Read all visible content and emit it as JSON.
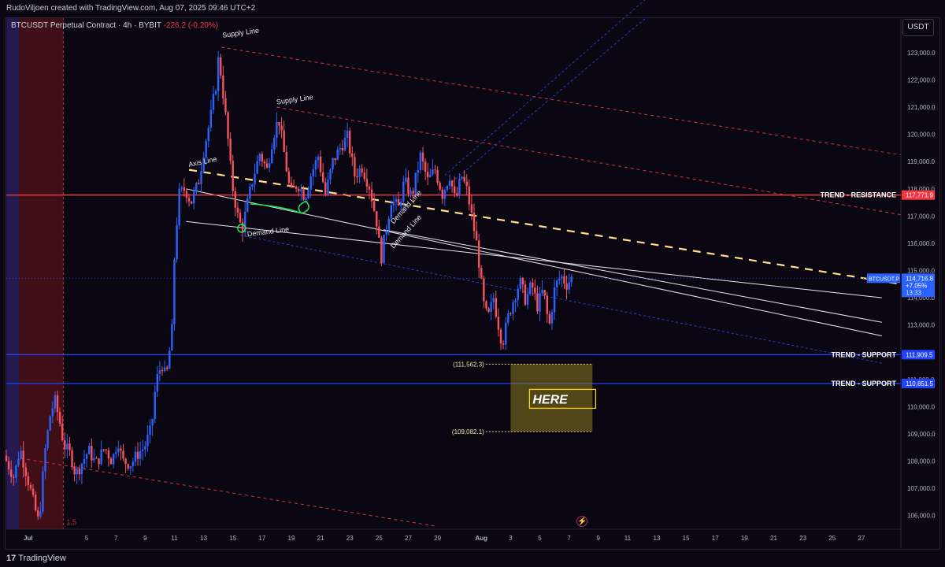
{
  "header": {
    "attribution": "RudoViljoen created with TradingView.com, Aug 07, 2025 09:46 UTC+2"
  },
  "legend": {
    "symbol": "BTCUSDT Perpetual Contract · 4h · BYBIT",
    "change": "-226.2 (-0.20%)"
  },
  "unit_button": "USDT",
  "footer": {
    "logo_mark": "17",
    "logo_text": "TradingView"
  },
  "colors": {
    "background": "#0b0712",
    "up": "#2962ff",
    "down": "#f7525f",
    "resistance": "#f23645",
    "support": "#2142ff",
    "axis_line": "#ffe08a",
    "zone": "#8c7a1f"
  },
  "chart_data": {
    "type": "candlestick",
    "symbol": "BTCUSDT.P",
    "timeframe": "4h",
    "exchange": "BYBIT",
    "ylim": [
      105500,
      124300
    ],
    "y_ticks": [
      106000,
      107000,
      108000,
      109000,
      110000,
      111000,
      112000,
      113000,
      114000,
      115000,
      116000,
      117000,
      118000,
      119000,
      120000,
      121000,
      122000,
      123000
    ],
    "y_tick_labels": [
      "106,000.0",
      "107,000.0",
      "108,000.0",
      "109,000.0",
      "110,000.0",
      "111,000.0",
      "112,000.0",
      "113,000.0",
      "114,000.0",
      "115,000.0",
      "116,000.0",
      "117,000.0",
      "118,000.0",
      "119,000.0",
      "120,000.0",
      "121,000.0",
      "122,000.0",
      "123,000.0"
    ],
    "x_ticks": [
      "Jul",
      "5",
      "7",
      "9",
      "11",
      "13",
      "15",
      "17",
      "19",
      "21",
      "23",
      "25",
      "27",
      "29",
      "Aug",
      "3",
      "5",
      "7",
      "9",
      "11",
      "13",
      "15",
      "17",
      "19",
      "21",
      "23",
      "25",
      "27"
    ],
    "x_tick_days": [
      1,
      5,
      7,
      9,
      11,
      13,
      15,
      17,
      19,
      21,
      23,
      25,
      27,
      29,
      32,
      34,
      36,
      38,
      40,
      42,
      44,
      46,
      48,
      50,
      52,
      54,
      56,
      58
    ],
    "x_domain_days": [
      -0.5,
      60.7
    ],
    "price_path": [
      [
        -0.5,
        108200
      ],
      [
        0.2,
        107400
      ],
      [
        0.6,
        108500
      ],
      [
        1.2,
        107200
      ],
      [
        1.6,
        106300
      ],
      [
        1.9,
        105700
      ],
      [
        2.3,
        108300
      ],
      [
        2.7,
        109800
      ],
      [
        3.0,
        110200
      ],
      [
        3.3,
        109500
      ],
      [
        3.6,
        108600
      ],
      [
        4.1,
        108200
      ],
      [
        4.4,
        107500
      ],
      [
        4.8,
        107900
      ],
      [
        5.3,
        108400
      ],
      [
        5.8,
        107900
      ],
      [
        6.4,
        108500
      ],
      [
        6.9,
        108000
      ],
      [
        7.3,
        108800
      ],
      [
        7.6,
        108000
      ],
      [
        8.2,
        107900
      ],
      [
        8.7,
        108300
      ],
      [
        9.1,
        108500
      ],
      [
        9.6,
        109200
      ],
      [
        9.9,
        110900
      ],
      [
        10.3,
        111600
      ],
      [
        10.6,
        111000
      ],
      [
        11.0,
        112800
      ],
      [
        11.2,
        116000
      ],
      [
        11.5,
        117800
      ],
      [
        11.9,
        118000
      ],
      [
        12.3,
        117500
      ],
      [
        12.8,
        118200
      ],
      [
        13.2,
        119500
      ],
      [
        13.6,
        120500
      ],
      [
        14.0,
        121800
      ],
      [
        14.2,
        122900
      ],
      [
        14.5,
        121500
      ],
      [
        14.8,
        120000
      ],
      [
        15.1,
        118200
      ],
      [
        15.5,
        117000
      ],
      [
        15.8,
        116500
      ],
      [
        16.1,
        117300
      ],
      [
        16.5,
        118300
      ],
      [
        17.0,
        119300
      ],
      [
        17.5,
        118700
      ],
      [
        17.9,
        119900
      ],
      [
        18.3,
        120600
      ],
      [
        18.7,
        119200
      ],
      [
        19.1,
        117800
      ],
      [
        19.6,
        118200
      ],
      [
        20.1,
        117700
      ],
      [
        20.5,
        118500
      ],
      [
        21.0,
        119200
      ],
      [
        21.5,
        117800
      ],
      [
        22.0,
        119000
      ],
      [
        22.6,
        119600
      ],
      [
        23.0,
        119900
      ],
      [
        23.5,
        118500
      ],
      [
        24.0,
        118800
      ],
      [
        24.5,
        118100
      ],
      [
        25.0,
        116800
      ],
      [
        25.3,
        115400
      ],
      [
        25.6,
        116400
      ],
      [
        26.0,
        117600
      ],
      [
        26.5,
        117300
      ],
      [
        26.9,
        118300
      ],
      [
        27.4,
        117700
      ],
      [
        28.0,
        119200
      ],
      [
        28.5,
        118300
      ],
      [
        29.0,
        118700
      ],
      [
        29.5,
        117800
      ],
      [
        30.0,
        118500
      ],
      [
        30.4,
        117500
      ],
      [
        30.8,
        118500
      ],
      [
        31.2,
        117900
      ],
      [
        31.6,
        116700
      ],
      [
        31.9,
        115800
      ],
      [
        32.3,
        113800
      ],
      [
        32.6,
        113200
      ],
      [
        33.0,
        114000
      ],
      [
        33.3,
        113100
      ],
      [
        33.6,
        112300
      ],
      [
        34.0,
        113300
      ],
      [
        34.4,
        114000
      ],
      [
        34.8,
        114600
      ],
      [
        35.2,
        113900
      ],
      [
        35.6,
        114500
      ],
      [
        36.0,
        113700
      ],
      [
        36.4,
        114300
      ],
      [
        36.8,
        112900
      ],
      [
        37.2,
        114400
      ],
      [
        37.6,
        114800
      ],
      [
        38.0,
        114500
      ],
      [
        38.3,
        114716.8
      ]
    ],
    "levels": [
      {
        "name": "TREND - RESISTANCE",
        "value": 117771.9,
        "price_label": "117,771.9"
      },
      {
        "name": "TREND - SUPPORT",
        "value": 111909.5,
        "price_label": "111,909.5"
      },
      {
        "name": "TREND - SUPPORT",
        "value": 110851.5,
        "price_label": "110,851.5"
      }
    ],
    "current_price": {
      "symbol": "BTCUSDT.P",
      "price": "114,716.8",
      "change": "+7.05%",
      "countdown": "13:33",
      "value": 114716.8
    },
    "zone": {
      "label": "HERE",
      "top": 111562.3,
      "bottom": 109082.1,
      "top_label": "(111,562.3)",
      "bottom_label": "(109,082.1)",
      "day_start": 34.0,
      "day_end": 39.6
    },
    "trendlines": [
      {
        "label": "Supply Line",
        "style": "dashed-red",
        "points": [
          [
            14.2,
            123200
          ],
          [
            60.7,
            119250
          ]
        ]
      },
      {
        "label": "Supply  Line",
        "style": "dashed-red",
        "points": [
          [
            18.0,
            121000
          ],
          [
            60.7,
            117050
          ]
        ]
      },
      {
        "label": "Axis Line",
        "style": "dashed-yellow",
        "points": [
          [
            12.0,
            118700
          ],
          [
            60.7,
            114500
          ]
        ]
      },
      {
        "label": "Demand Line",
        "style": "solid-white",
        "points": [
          [
            11.8,
            118000
          ],
          [
            59.4,
            112600
          ]
        ]
      },
      {
        "label": "",
        "style": "solid-white",
        "points": [
          [
            11.8,
            116800
          ],
          [
            59.4,
            114000
          ]
        ]
      },
      {
        "label": "Demand Line",
        "style": "solid-white",
        "points": [
          [
            25.3,
            116500
          ],
          [
            59.4,
            113100
          ]
        ]
      },
      {
        "label": "Demand Line",
        "style": "dashed-blue",
        "points": [
          [
            15.5,
            116300
          ],
          [
            59.4,
            111600
          ]
        ]
      },
      {
        "label": "",
        "style": "dashed-red",
        "points": [
          [
            0.5,
            108100
          ],
          [
            29.0,
            105600
          ]
        ]
      },
      {
        "label": "",
        "style": "dashed-blue",
        "points": [
          [
            29.5,
            118500
          ],
          [
            43.3,
            125000
          ]
        ]
      }
    ],
    "annotations": [
      "Supply Line",
      "Supply  Line",
      "Axis Line",
      "Demand Line",
      "Demand Line",
      "Demand Line",
      "1.5"
    ],
    "shaded_region": {
      "day_start": -0.5,
      "day_end": 3.4
    }
  }
}
